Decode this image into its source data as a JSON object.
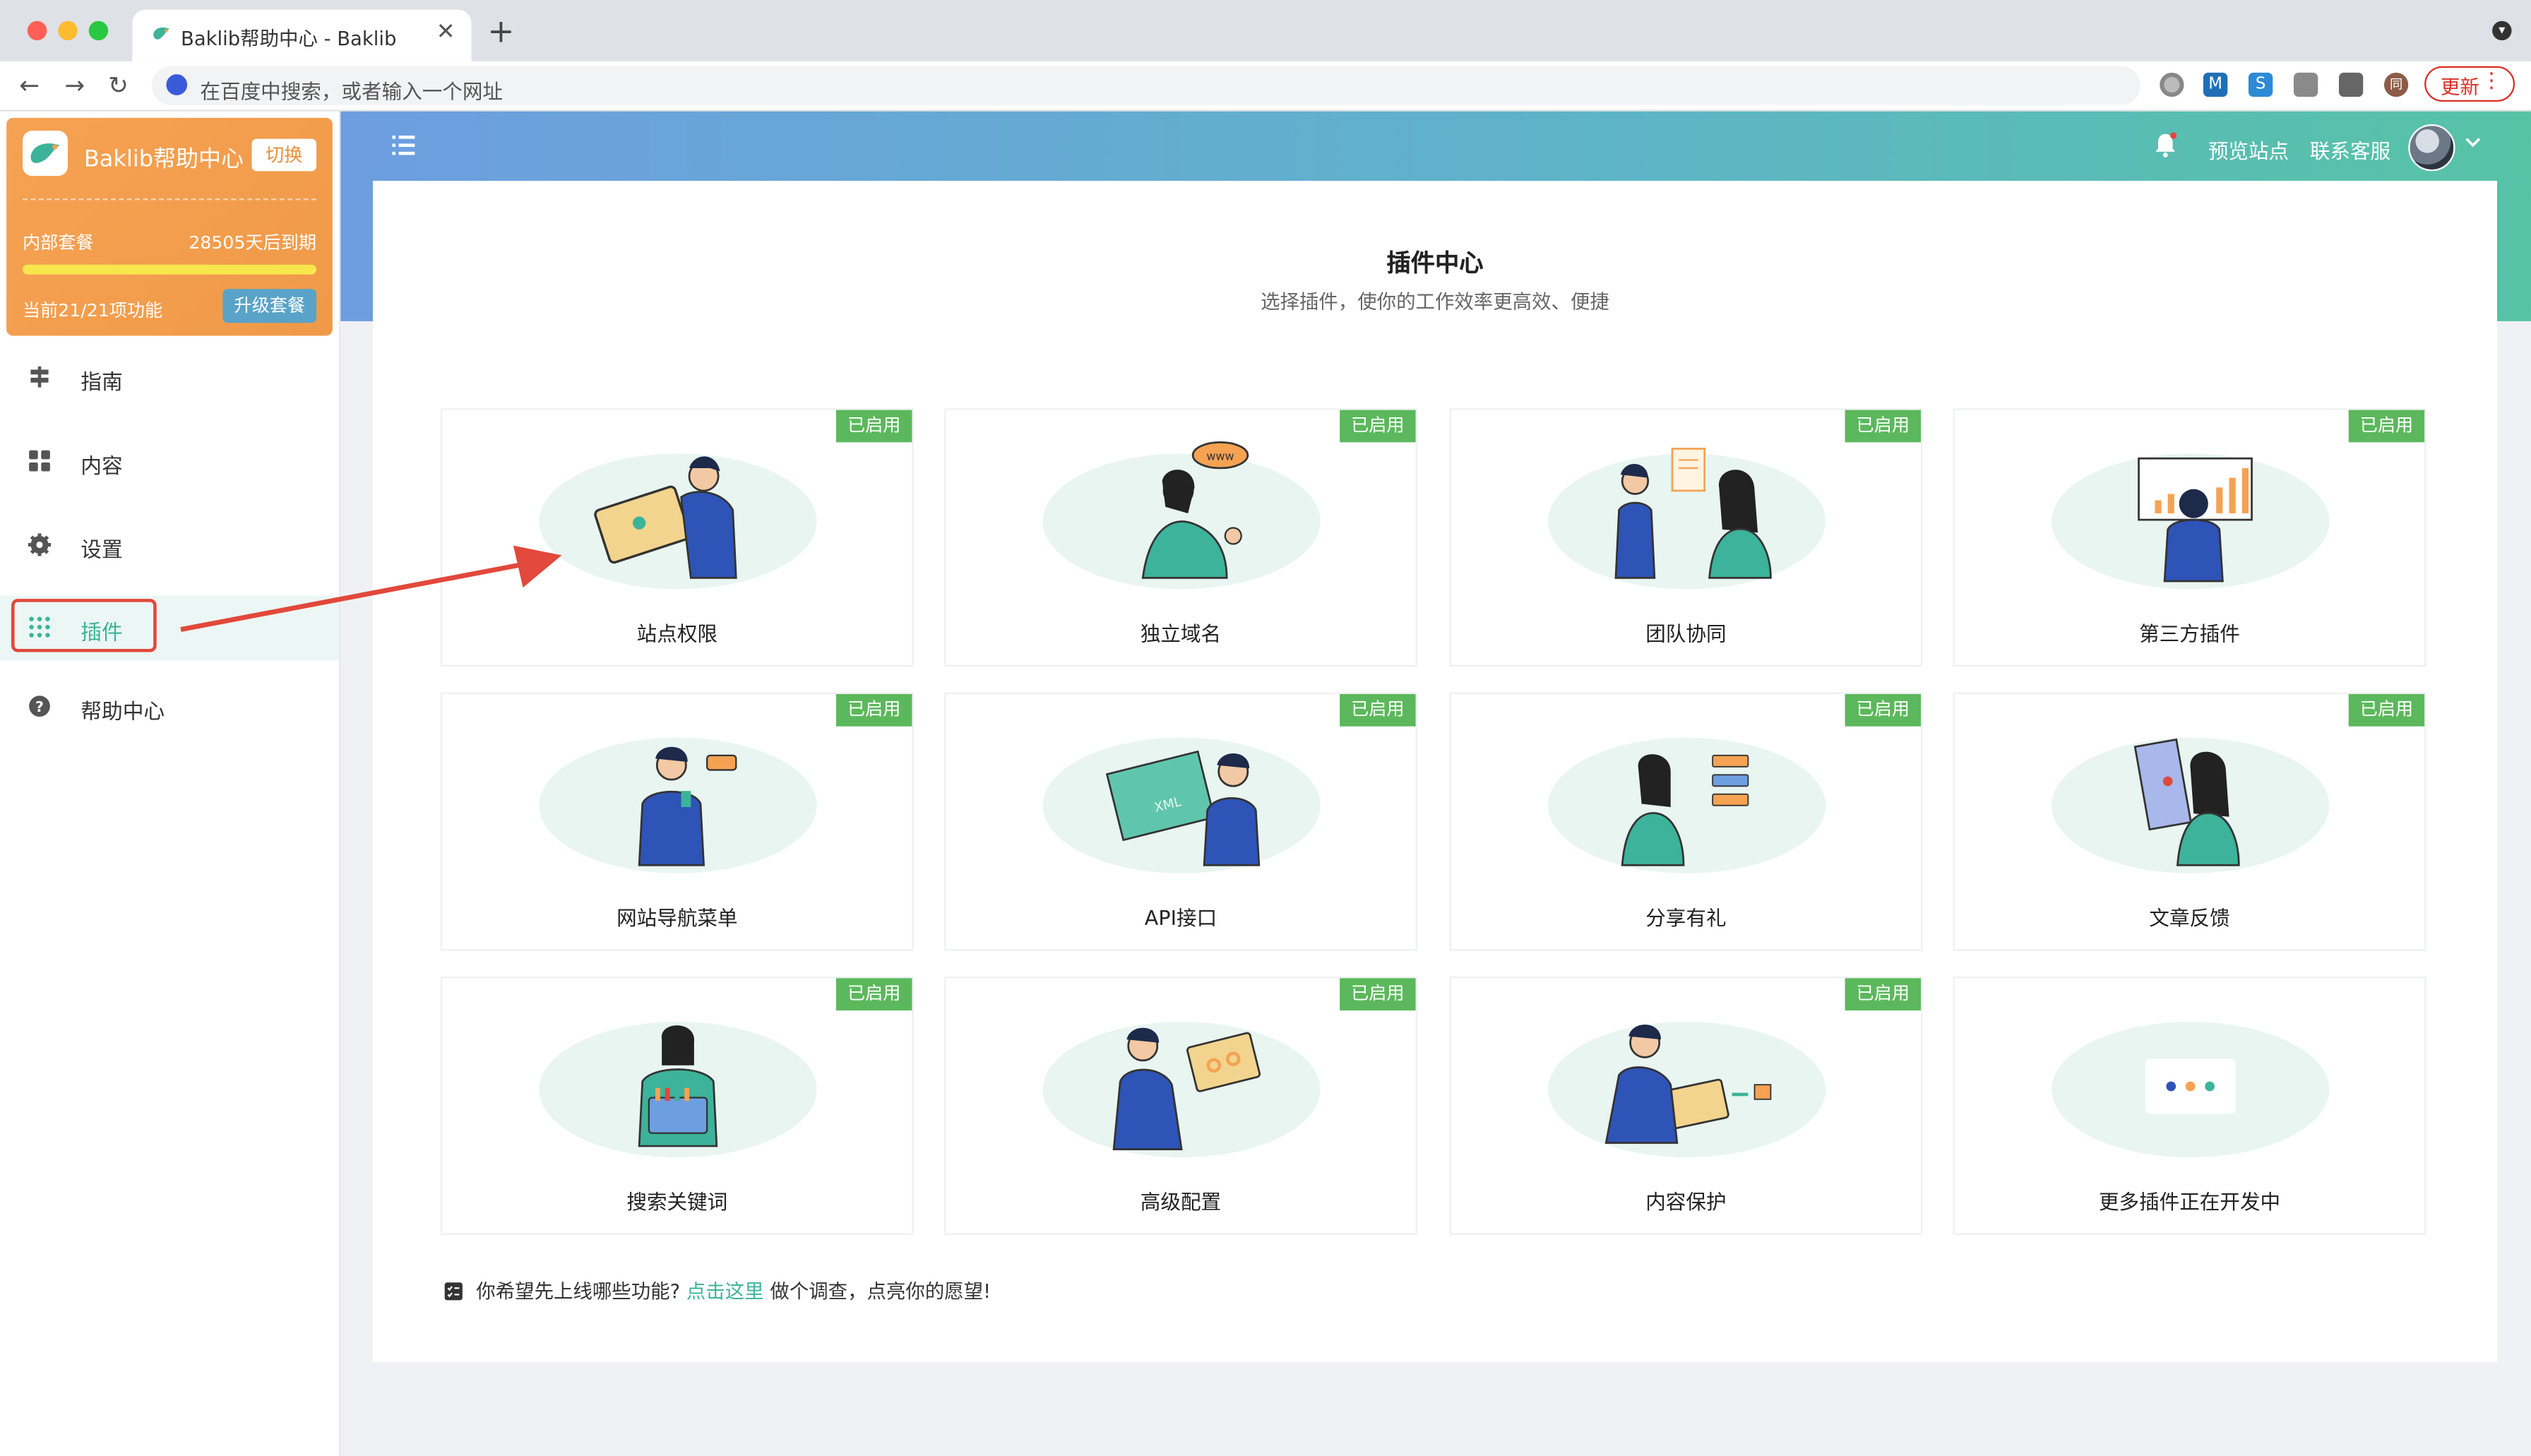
{
  "browser": {
    "tab_title": "Baklib帮助中心 - Baklib",
    "address_placeholder": "在百度中搜索，或者输入一个网址",
    "update_label": "更新",
    "extensions": [
      "globe-icon",
      "m-extension-icon",
      "s-extension-icon",
      "camera-icon",
      "puzzle-icon",
      "profile-icon"
    ]
  },
  "sidebar": {
    "brand_name": "Baklib帮助中心",
    "switch_label": "切换",
    "plan_name": "内部套餐",
    "expire_text": "28505天后到期",
    "progress_fraction": 1.0,
    "features_text": "当前21/21项功能",
    "upgrade_label": "升级套餐",
    "items": [
      {
        "label": "指南",
        "icon": "signpost-icon"
      },
      {
        "label": "内容",
        "icon": "grid-icon"
      },
      {
        "label": "设置",
        "icon": "gear-icon"
      },
      {
        "label": "插件",
        "icon": "apps-icon",
        "active": true
      },
      {
        "label": "帮助中心",
        "icon": "help-icon"
      }
    ]
  },
  "header": {
    "preview_label": "预览站点",
    "support_label": "联系客服"
  },
  "main": {
    "title": "插件中心",
    "subtitle": "选择插件，使你的工作效率更高效、便捷",
    "badge_label": "已启用",
    "plugins": [
      {
        "name": "站点权限",
        "enabled": true
      },
      {
        "name": "独立域名",
        "enabled": true
      },
      {
        "name": "团队协同",
        "enabled": true
      },
      {
        "name": "第三方插件",
        "enabled": true
      },
      {
        "name": "网站导航菜单",
        "enabled": true
      },
      {
        "name": "API接口",
        "enabled": true
      },
      {
        "name": "分享有礼",
        "enabled": true
      },
      {
        "name": "文章反馈",
        "enabled": true
      },
      {
        "name": "搜索关键词",
        "enabled": true
      },
      {
        "name": "高级配置",
        "enabled": true
      },
      {
        "name": "内容保护",
        "enabled": true
      },
      {
        "name": "更多插件正在开发中",
        "enabled": false
      }
    ],
    "survey_prefix": "你希望先上线哪些功能?",
    "survey_link": "点击这里",
    "survey_suffix": "做个调查，点亮你的愿望!"
  },
  "colors": {
    "accent": "#3cb39a",
    "badge": "#5cb85c",
    "brand_card": "#f09a48",
    "highlight": "#e2483b"
  }
}
